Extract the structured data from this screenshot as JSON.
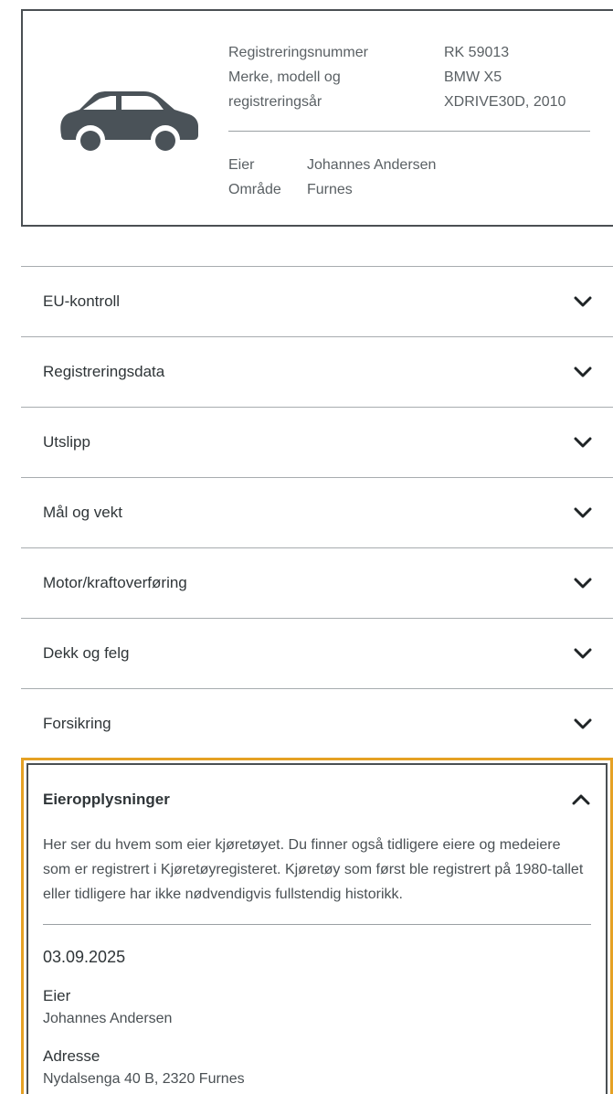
{
  "vehicle": {
    "icon": "car-icon",
    "reg_label": "Registreringsnummer",
    "reg_value": "RK 59013",
    "model_label_1": "Merke, modell og",
    "model_label_2": "registreringsår",
    "model_value_1": "BMW X5",
    "model_value_2": "XDRIVE30D, 2010",
    "owner_label": "Eier",
    "owner_value": "Johannes Andersen",
    "area_label": "Område",
    "area_value": "Furnes"
  },
  "accordion": {
    "items": [
      {
        "label": "EU-kontroll"
      },
      {
        "label": "Registreringsdata"
      },
      {
        "label": "Utslipp"
      },
      {
        "label": "Mål og vekt"
      },
      {
        "label": "Motor/kraftoverføring"
      },
      {
        "label": "Dekk og felg"
      },
      {
        "label": "Forsikring"
      }
    ]
  },
  "owner_info": {
    "title": "Eieropplysninger",
    "description": "Her ser du hvem som eier kjøretøyet. Du finner også tidligere eiere og medeiere som er registrert i Kjøretøyregisteret. Kjøretøy som først ble registrert på 1980-tallet eller tidligere har ikke nødvendigvis fullstendig historikk.",
    "date": "03.09.2025",
    "owner_label": "Eier",
    "owner_value": "Johannes Andersen",
    "address_label": "Adresse",
    "address_value": "Nydalsenga 40 B, 2320 Furnes"
  },
  "colors": {
    "focus_outline": "#e5a124",
    "border": "#4a4f53",
    "car": "#4a5258"
  }
}
